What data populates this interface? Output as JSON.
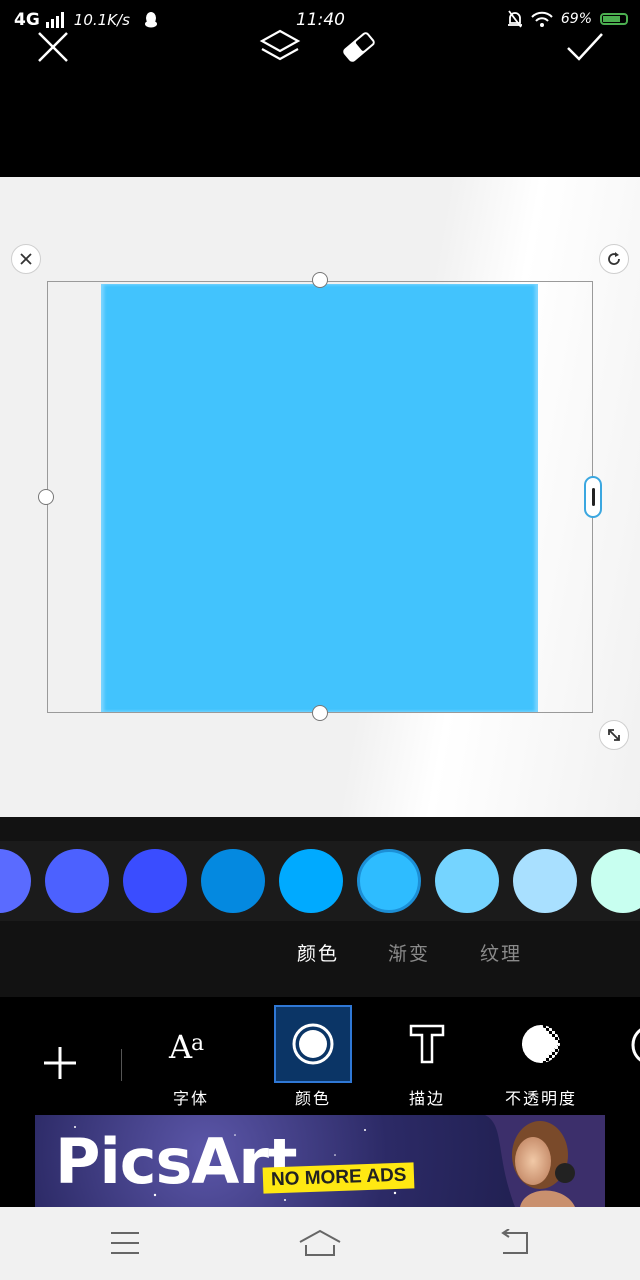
{
  "status_bar": {
    "network": "4G",
    "speed": "10.1K/s",
    "time": "11:40",
    "battery": "69%"
  },
  "toolbar": {
    "close_icon": "close-icon",
    "layers_icon": "layers-icon",
    "eraser_icon": "eraser-icon",
    "confirm_icon": "check-icon"
  },
  "canvas": {
    "shape_color": "#42c3fd",
    "background": "#f1f1f1"
  },
  "colors": {
    "swatches": [
      "#5a6bff",
      "#4c61ff",
      "#3a4dff",
      "#0489e0",
      "#00aaff",
      "#2ebcff",
      "#75d4ff",
      "#a9e0ff",
      "#c8fff0"
    ],
    "selected_index": 5
  },
  "subtabs": [
    {
      "label": "颜色",
      "active": true
    },
    {
      "label": "渐变",
      "active": false
    },
    {
      "label": "纹理",
      "active": false
    }
  ],
  "tools": [
    {
      "label": "字体",
      "icon": "font-icon",
      "active": false
    },
    {
      "label": "颜色",
      "icon": "color-icon",
      "active": true
    },
    {
      "label": "描边",
      "icon": "stroke-icon",
      "active": false
    },
    {
      "label": "不透明度",
      "icon": "opacity-icon",
      "active": false
    }
  ],
  "ad": {
    "logo": "PicsArt",
    "tag": "NO MORE ADS"
  },
  "nav": {
    "menu_icon": "menu-icon",
    "home_icon": "home-icon",
    "back_icon": "back-icon"
  }
}
